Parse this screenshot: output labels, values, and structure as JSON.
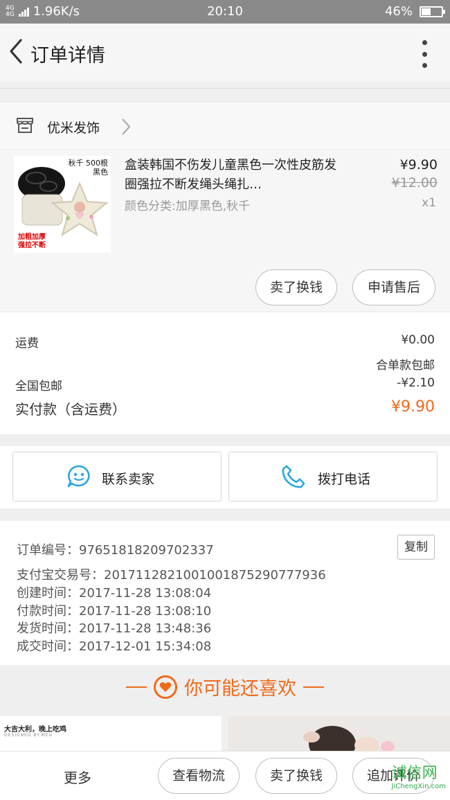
{
  "status_bar": {
    "network": "4G",
    "network2": "4G",
    "speed": "1.96K/s",
    "time": "20:10",
    "battery_text": "46%",
    "battery_level": 0.46
  },
  "nav": {
    "title": "订单详情",
    "back_icon": "chevron-left-icon",
    "more_icon": "more-vertical-icon"
  },
  "shop": {
    "name": "优米发饰",
    "store_icon": "store-icon",
    "chevron_icon": "chevron-right-icon"
  },
  "goods": {
    "image_tag": [
      "秋千 500根",
      "黑色"
    ],
    "image_badge": [
      "加粗加厚",
      "强拉不断"
    ],
    "title": "盒装韩国不伤发儿童黑色一次性皮筋发圈强拉不断发绳头绳扎…",
    "sku": "颜色分类:加厚黑色,秋千",
    "price": "¥9.90",
    "original_price": "¥12.00",
    "quantity": "x1",
    "sell_button": "卖了换钱",
    "aftersale_button": "申请售后"
  },
  "fees": {
    "shipping_label": "运费",
    "shipping_value": "¥0.00",
    "shipping_note": "合单款包邮",
    "free_shipping_label": "全国包邮",
    "free_shipping_value": "-¥2.10",
    "total_label": "实付款（含运费）",
    "total_value": "¥9.90"
  },
  "contact": {
    "seller_label": "联系卖家",
    "phone_label": "拨打电话",
    "seller_icon": "chat-bubble-icon",
    "phone_icon": "phone-icon"
  },
  "order_info": {
    "order_no": "订单编号：97651818209702337",
    "copy_button": "复制",
    "alipay_no": "支付宝交易号：2017112821001001875290777936",
    "created": "创建时间：2017-11-28  13:08:04",
    "paid": "付款时间：2017-11-28  13:08:10",
    "shipped": "发货时间：2017-11-28  13:48:36",
    "completed": "成交时间：2017-12-01  15:34:08"
  },
  "recommend": {
    "title": "你可能还喜欢",
    "icon": "heart-icon",
    "card1_title": "大吉大利，晚上吃鸡",
    "card1_sub": "DESIGNED BY.MEU"
  },
  "bottom_bar": {
    "more": "更多",
    "logistics": "查看物流",
    "sell": "卖了换钱",
    "review": "追加评价"
  },
  "watermark": {
    "brand": "诚信网",
    "url": "JiChengXin.com"
  },
  "colors": {
    "accent": "#f06a1b",
    "icon_blue": "#2aa6e0"
  }
}
